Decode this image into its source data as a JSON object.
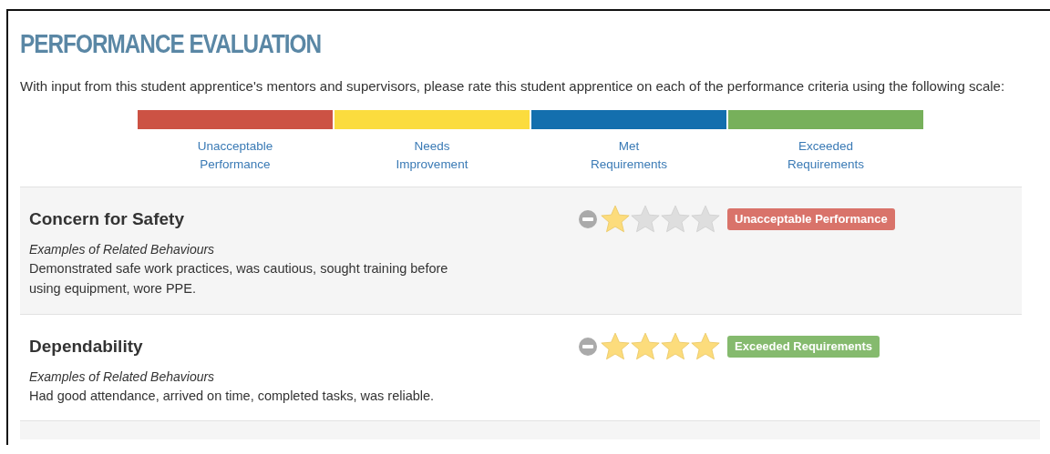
{
  "title": "PERFORMANCE EVALUATION",
  "intro": "With input from this student apprentice's mentors and supervisors, please rate this student apprentice on each of the performance criteria using the following scale:",
  "scale": [
    {
      "label": "Unacceptable Performance",
      "color": "#cc5244"
    },
    {
      "label": "Needs Improvement",
      "color": "#fbdc3e"
    },
    {
      "label": "Met Requirements",
      "color": "#146fae"
    },
    {
      "label": "Exceeded Requirements",
      "color": "#77b05b"
    }
  ],
  "criteria": [
    {
      "name": "Concern for Safety",
      "examples_heading": "Examples of Related Behaviours",
      "examples": "Demonstrated safe work practices, was cautious, sought training before using equipment, wore PPE.",
      "stars": 1,
      "rating_label": "Unacceptable Performance",
      "color": "#d9736a"
    },
    {
      "name": "Dependability",
      "examples_heading": "Examples of Related Behaviours",
      "examples": "Had good attendance, arrived on time, completed tasks, was reliable.",
      "stars": 4,
      "rating_label": "Exceeded Requirements",
      "color": "#85ba6e"
    }
  ]
}
